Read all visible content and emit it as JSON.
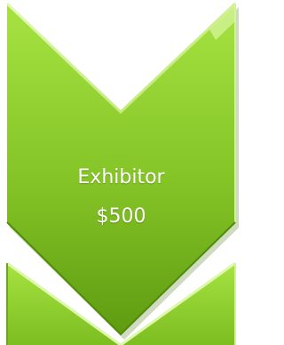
{
  "chevrons": [
    {
      "lines": [
        "Exhibitor",
        "$500"
      ]
    }
  ],
  "colors": {
    "fill_top": "#a3e03f",
    "fill_bottom": "#5e9a10",
    "edge_light": "#dcf5a6",
    "edge_dark": "#4e8a06",
    "background": "#ffffff"
  }
}
